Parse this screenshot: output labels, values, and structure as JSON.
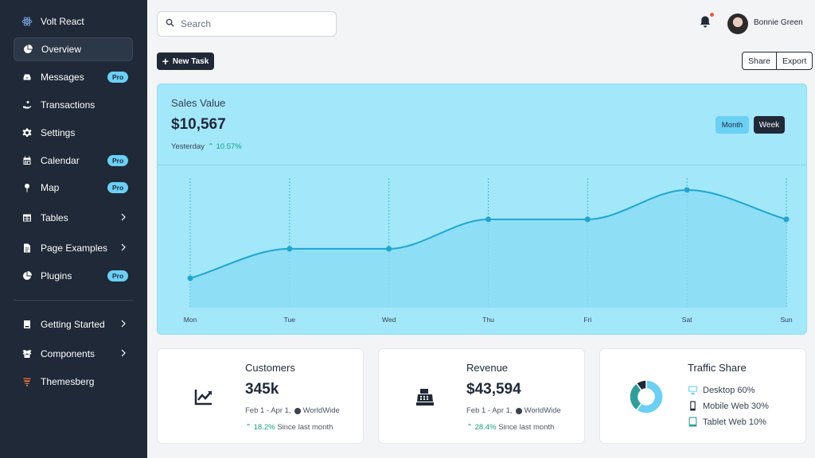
{
  "sidebar": {
    "brand": "Volt React",
    "items": [
      {
        "label": "Overview",
        "active": true
      },
      {
        "label": "Messages",
        "badge": "Pro"
      },
      {
        "label": "Transactions"
      },
      {
        "label": "Settings"
      },
      {
        "label": "Calendar",
        "badge": "Pro"
      },
      {
        "label": "Map",
        "badge": "Pro"
      },
      {
        "label": "Tables"
      },
      {
        "label": "Page Examples"
      },
      {
        "label": "Plugins",
        "badge": "Pro"
      },
      {
        "label": "Getting Started"
      },
      {
        "label": "Components"
      },
      {
        "label": "Themesberg"
      }
    ]
  },
  "topbar": {
    "search_placeholder": "Search",
    "user_name": "Bonnie Green"
  },
  "actions": {
    "new_task": "New Task",
    "share": "Share",
    "export": "Export"
  },
  "sales": {
    "title": "Sales Value",
    "value": "$10,567",
    "period": "Yesterday",
    "change": "10.57%",
    "toggle_month": "Month",
    "toggle_week": "Week"
  },
  "chart_data": {
    "type": "area",
    "categories": [
      "Mon",
      "Tue",
      "Wed",
      "Thu",
      "Fri",
      "Sat",
      "Sun"
    ],
    "series": [
      {
        "values": [
          1,
          2,
          2,
          3,
          3,
          4,
          3
        ]
      }
    ],
    "ylim": [
      0,
      4.4
    ],
    "grid": "vertical-dashed",
    "colors": {
      "line": "#1ea6d0",
      "fill": "#8bdcf5",
      "background": "#a3e7fb"
    }
  },
  "cards": {
    "customers": {
      "title": "Customers",
      "value": "345k",
      "period": "Feb 1 - Apr 1,",
      "region": "WorldWide",
      "change": "18.2%",
      "since": "Since last month"
    },
    "revenue": {
      "title": "Revenue",
      "value": "$43,594",
      "period": "Feb 1 - Apr 1,",
      "region": "WorldWide",
      "change": "28.4%",
      "since": "Since last month"
    },
    "traffic": {
      "title": "Traffic Share",
      "items": [
        {
          "label": "Desktop 60%",
          "value": 60,
          "color": "#6ad0f5"
        },
        {
          "label": "Mobile Web 30%",
          "value": 30,
          "color": "#2f9e9a"
        },
        {
          "label": "Tablet Web 10%",
          "value": 10,
          "color": "#1f2937"
        }
      ]
    }
  },
  "colors": {
    "sidebar": "#1f2937",
    "accent": "#6ad0f5",
    "positive": "#10a37f"
  }
}
